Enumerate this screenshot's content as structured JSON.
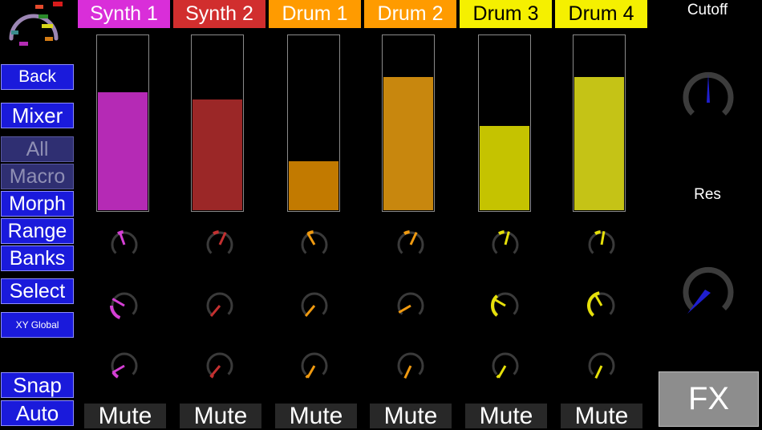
{
  "app": {
    "nav": {
      "back": "Back",
      "mixer": "Mixer",
      "all": "All",
      "macro": "Macro",
      "morph": "Morph",
      "range": "Range",
      "banks": "Banks",
      "select": "Select",
      "xy_global": "XY Global",
      "snap": "Snap",
      "auto": "Auto"
    },
    "channels": [
      {
        "name": "Synth 1",
        "tab_color": "#d92ed9",
        "tab_text_color": "#ffffff",
        "fill_color": "#b52ab5",
        "level": 0.67,
        "knob_color": "#d43fd4",
        "mute": "Mute"
      },
      {
        "name": "Synth 2",
        "tab_color": "#d12e2e",
        "tab_text_color": "#ffffff",
        "fill_color": "#9b2727",
        "level": 0.63,
        "knob_color": "#c33030",
        "mute": "Mute"
      },
      {
        "name": "Drum 1",
        "tab_color": "#ff9b00",
        "tab_text_color": "#ffffff",
        "fill_color": "#c27a00",
        "level": 0.28,
        "knob_color": "#f09a10",
        "mute": "Mute"
      },
      {
        "name": "Drum 2",
        "tab_color": "#ff9b00",
        "tab_text_color": "#ffffff",
        "fill_color": "#c8870e",
        "level": 0.76,
        "knob_color": "#f09a10",
        "mute": "Mute"
      },
      {
        "name": "Drum 3",
        "tab_color": "#f5f000",
        "tab_text_color": "#000000",
        "fill_color": "#c5c300",
        "level": 0.48,
        "knob_color": "#e6e00a",
        "mute": "Mute"
      },
      {
        "name": "Drum 4",
        "tab_color": "#f5f000",
        "tab_text_color": "#000000",
        "fill_color": "#c5c316",
        "level": 0.76,
        "knob_color": "#e6e00a",
        "mute": "Mute"
      }
    ],
    "right_panel": {
      "cutoff_label": "Cutoff",
      "res_label": "Res",
      "fx_label": "FX"
    }
  }
}
